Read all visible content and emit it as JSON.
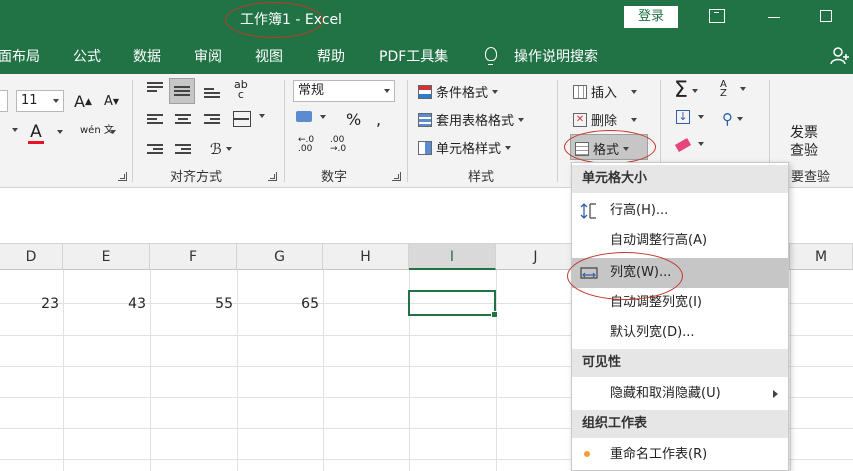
{
  "window": {
    "title": "工作簿1  -  Excel",
    "login_label": "登录"
  },
  "tabs": [
    {
      "label": "面布局"
    },
    {
      "label": "公式"
    },
    {
      "label": "数据"
    },
    {
      "label": "审阅"
    },
    {
      "label": "视图"
    },
    {
      "label": "帮助"
    },
    {
      "label": "PDF工具集"
    },
    {
      "label": "操作说明搜索"
    }
  ],
  "ribbon": {
    "font_size_value": "11",
    "number_format_value": "常规",
    "alignment_group_label": "对齐方式",
    "number_group_label": "数字",
    "styles_group_label": "样式",
    "percent_symbol": "%",
    "increase_font": "A",
    "decrease_font": "A",
    "phonetic_label": "wén 文",
    "decimal_increase": "←.0 .00",
    "decimal_decrease": ".00 →.0",
    "conditional_format": "条件格式",
    "table_format": "套用表格格式",
    "cell_styles": "单元格样式",
    "insert": "插入",
    "delete": "删除",
    "format": "格式",
    "sum_symbol": "Σ",
    "sort_symbol": "A Z",
    "invoice_check_line1": "发票",
    "invoice_check_line2": "查验",
    "invoice_check_group_label": "要查验"
  },
  "grid": {
    "columns": [
      "D",
      "E",
      "F",
      "G",
      "H",
      "I",
      "J",
      "M"
    ],
    "row1_values": [
      "23",
      "43",
      "55",
      "65"
    ]
  },
  "menu": {
    "section_cell_size": "单元格大小",
    "row_height": "行高(H)...",
    "autofit_row_height": "自动调整行高(A)",
    "column_width": "列宽(W)...",
    "autofit_column_width": "自动调整列宽(I)",
    "default_width": "默认列宽(D)...",
    "section_visibility": "可见性",
    "hide_unhide": "隐藏和取消隐藏(U)",
    "section_organize": "组织工作表",
    "rename_sheet": "重命名工作表(R)"
  },
  "colors": {
    "excel_green": "#217346",
    "annotation_red": "#c0392b",
    "ribbon_bg": "#f3f3f3",
    "menu_section_bg": "#e6e6e6",
    "menu_hover_bg": "#c6c6c6"
  }
}
